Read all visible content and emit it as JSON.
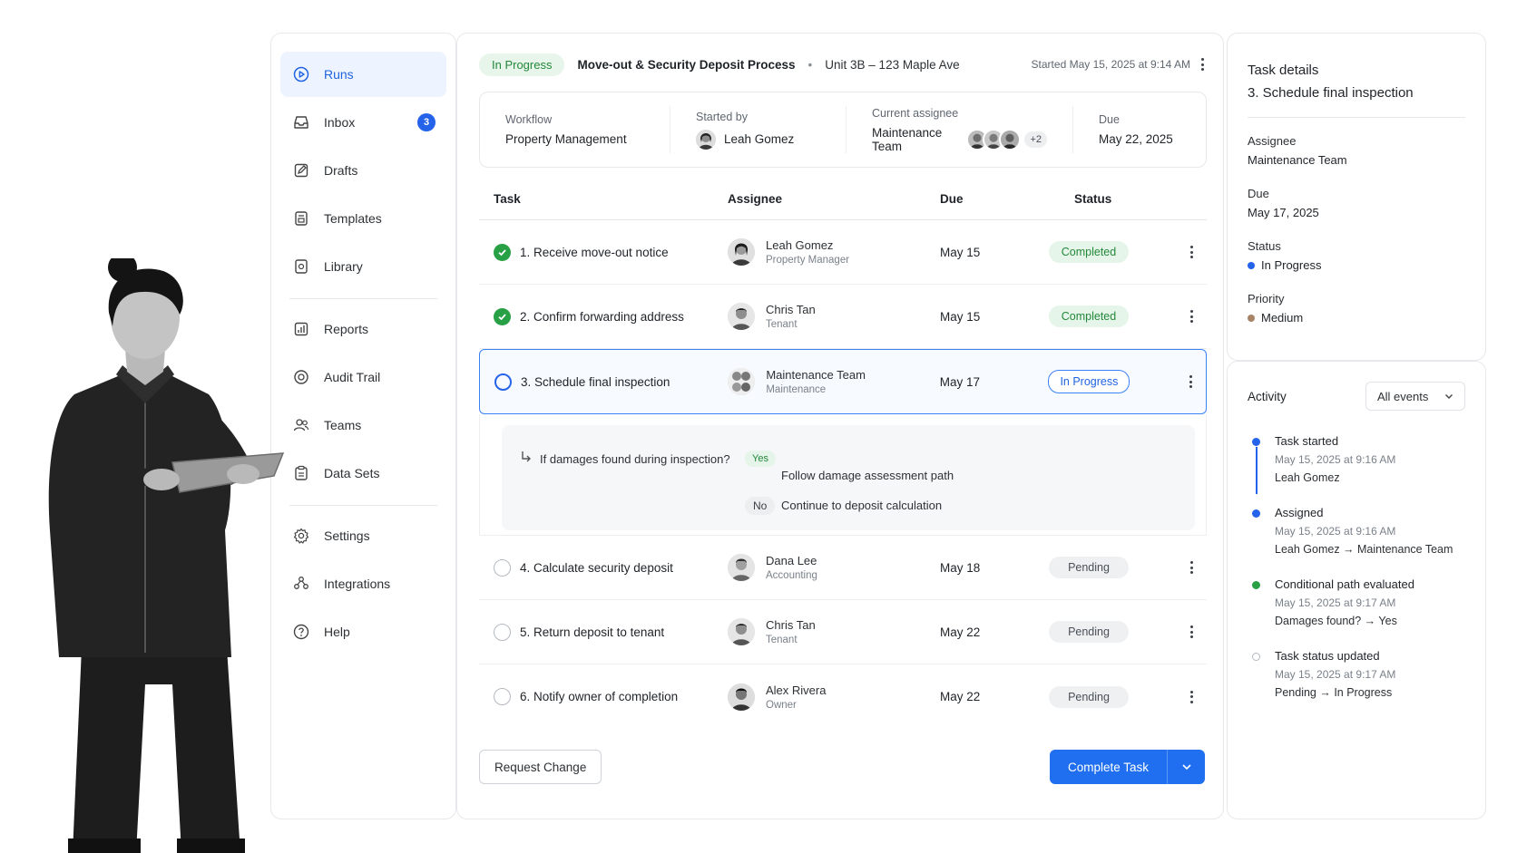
{
  "sidebar": {
    "items": [
      {
        "label": "Runs",
        "icon": "play-circle-icon",
        "active": true
      },
      {
        "label": "Inbox",
        "icon": "inbox-icon",
        "badge": "3"
      },
      {
        "label": "Drafts",
        "icon": "edit-icon"
      },
      {
        "label": "Templates",
        "icon": "template-icon"
      },
      {
        "label": "Library",
        "icon": "library-icon"
      },
      {
        "label": "Reports",
        "icon": "chart-icon"
      },
      {
        "label": "Audit Trail",
        "icon": "audit-icon"
      },
      {
        "label": "Teams",
        "icon": "users-icon"
      },
      {
        "label": "Data Sets",
        "icon": "database-icon"
      },
      {
        "label": "Settings",
        "icon": "gear-icon"
      },
      {
        "label": "Integrations",
        "icon": "plug-icon"
      },
      {
        "label": "Help",
        "icon": "help-icon"
      }
    ]
  },
  "run": {
    "status": "In Progress",
    "title": "Move-out & Security Deposit Process",
    "separator": "•",
    "unit": "Unit 3B – 123 Maple Ave",
    "started": "Started May 15, 2025 at 9:14 AM"
  },
  "meta": {
    "workflow_label": "Workflow",
    "workflow_value": "Property Management",
    "started_by_label": "Started by",
    "started_by_value": "Leah Gomez",
    "assignee_label": "Current assignee",
    "assignee_value": "Maintenance Team",
    "assignee_more": "+2",
    "due_label": "Due",
    "due_value": "May 22, 2025"
  },
  "table": {
    "headers": {
      "task": "Task",
      "assignee": "Assignee",
      "due": "Due",
      "status": "Status"
    },
    "rows": [
      {
        "task": "1. Receive move-out notice",
        "name": "Leah Gomez",
        "role": "Property Manager",
        "due": "May 15",
        "status": "Completed"
      },
      {
        "task": "2. Confirm forwarding address",
        "name": "Chris Tan",
        "role": "Tenant",
        "due": "May 15",
        "status": "Completed"
      },
      {
        "task": "3. Schedule final inspection",
        "name": "Maintenance Team",
        "role": "Maintenance",
        "due": "May 17",
        "status": "In Progress"
      },
      {
        "task": "4. Calculate security deposit",
        "name": "Dana Lee",
        "role": "Accounting",
        "due": "May 18",
        "status": "Pending"
      },
      {
        "task": "5. Return deposit to tenant",
        "name": "Chris Tan",
        "role": "Tenant",
        "due": "May 22",
        "status": "Pending"
      },
      {
        "task": "6. Notify owner of completion",
        "name": "Alex Rivera",
        "role": "Owner",
        "due": "May 22",
        "status": "Pending"
      }
    ]
  },
  "condition": {
    "question": "If damages found during inspection?",
    "yes_label": "Yes",
    "yes_path": "Follow damage assessment path",
    "no_label": "No",
    "no_path": "Continue to deposit calculation"
  },
  "footer": {
    "request_change": "Request Change",
    "complete_task": "Complete Task"
  },
  "details": {
    "title": "Task details",
    "task": "3. Schedule final inspection",
    "assignee_label": "Assignee",
    "assignee_value": "Maintenance Team",
    "due_label": "Due",
    "due_value": "May 17, 2025",
    "status_label": "Status",
    "status_value": "In Progress",
    "priority_label": "Priority",
    "priority_value": "Medium"
  },
  "activity": {
    "title": "Activity",
    "filter": "All events",
    "events": [
      {
        "title": "Task started",
        "time": "May 15, 2025 at 9:16 AM",
        "detail": "Leah Gomez"
      },
      {
        "title": "Assigned",
        "time": "May 15, 2025 at 9:16 AM",
        "detail": "Leah Gomez → Maintenance Team"
      },
      {
        "title": "Conditional path evaluated",
        "time": "May 15, 2025 at 9:17 AM",
        "detail": "Damages found? → Yes"
      },
      {
        "title": "Task status updated",
        "time": "May 15, 2025 at 9:17 AM",
        "detail": "Pending → In Progress"
      }
    ]
  },
  "colors": {
    "accent": "#1f6ff0",
    "success": "#27a046",
    "progress_dot": "#2563eb",
    "priority_medium": "#a88466"
  }
}
